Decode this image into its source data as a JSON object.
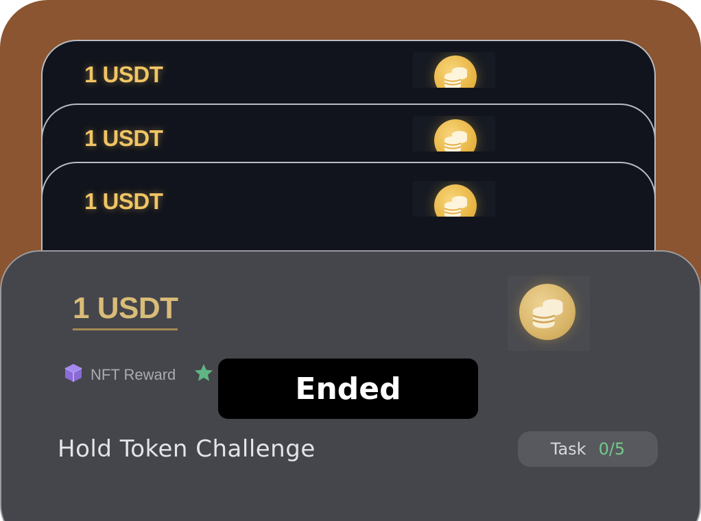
{
  "stack_cards": [
    {
      "amount": "1 USDT",
      "icon": "coins-icon"
    },
    {
      "amount": "1 USDT",
      "icon": "coins-icon"
    },
    {
      "amount": "1 USDT",
      "icon": "coins-icon"
    }
  ],
  "front_card": {
    "amount": "1 USDT",
    "icon": "coins-icon",
    "tags": [
      {
        "icon": "cube-icon",
        "label": "NFT Reward",
        "color": "#8a6ad6"
      },
      {
        "icon": "star-icon",
        "color": "#5fb683"
      }
    ],
    "title": "Hold Token Challenge",
    "task": {
      "label": "Task",
      "progress": "0/5"
    }
  },
  "overlay": {
    "status": "Ended"
  },
  "colors": {
    "frame": "#8a5530",
    "back_card": "#11141c",
    "front_card": "#45464b",
    "gold": "#f1c565",
    "progress_green": "#74c98b"
  }
}
